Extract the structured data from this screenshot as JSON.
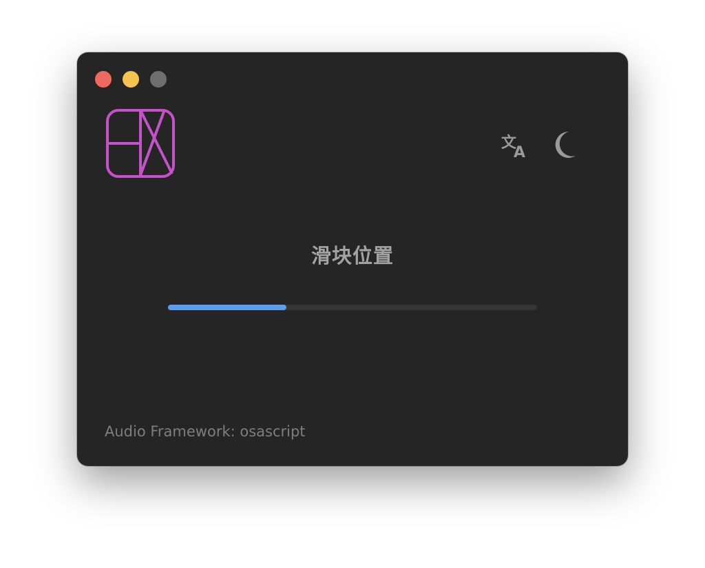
{
  "window": {
    "controls": [
      "close",
      "minimize",
      "zoom"
    ]
  },
  "logo": {
    "icon": "hx-logo-icon",
    "color": "#c552c9"
  },
  "toolbar": {
    "translate_icon": "translate-icon",
    "theme_icon": "moon-icon"
  },
  "main": {
    "title": "滑块位置",
    "slider": {
      "value_fraction": 0.32,
      "fill_color": "#5c9df0"
    }
  },
  "footer": {
    "text": "Audio Framework: osascript"
  }
}
